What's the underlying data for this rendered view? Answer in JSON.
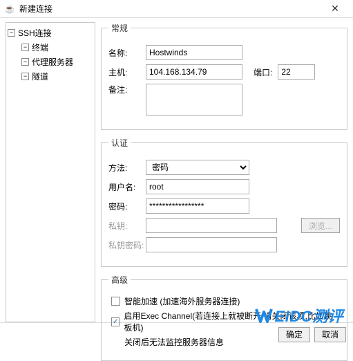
{
  "window": {
    "title": "新建连接",
    "close_icon": "✕",
    "app_icon": "☕"
  },
  "sidebar": {
    "root_label": "SSH连接",
    "root_toggle": "−",
    "items": [
      {
        "label": "终端",
        "toggle": "−"
      },
      {
        "label": "代理服务器",
        "toggle": "−"
      },
      {
        "label": "隧道",
        "toggle": "−"
      }
    ]
  },
  "general": {
    "legend": "常规",
    "name_label": "名称:",
    "name_value": "Hostwinds",
    "host_label": "主机:",
    "host_value": "104.168.134.79",
    "port_label": "端口:",
    "port_value": "22",
    "note_label": "备注:",
    "note_value": ""
  },
  "auth": {
    "legend": "认证",
    "method_label": "方法:",
    "method_value": "密码",
    "user_label": "用户名:",
    "user_value": "root",
    "pass_label": "密码:",
    "pass_value": "*****************",
    "key_label": "私钥:",
    "key_value": "",
    "browse_label": "浏览...",
    "keypass_label": "私钥密码:",
    "keypass_value": ""
  },
  "advanced": {
    "legend": "高级",
    "accel_label": "智能加速 (加速海外服务器连接)",
    "accel_checked": false,
    "exec_label": "启用Exec Channel(若连接上就被断开,请关闭该项,比如跳板机)",
    "exec_checked": true,
    "exec_check_glyph": "✓",
    "exec_note": "关闭后无法监控服务器信息"
  },
  "footer": {
    "ok_label": "确定",
    "cancel_label": "取消"
  },
  "watermark": {
    "text": "EIDC测评"
  }
}
